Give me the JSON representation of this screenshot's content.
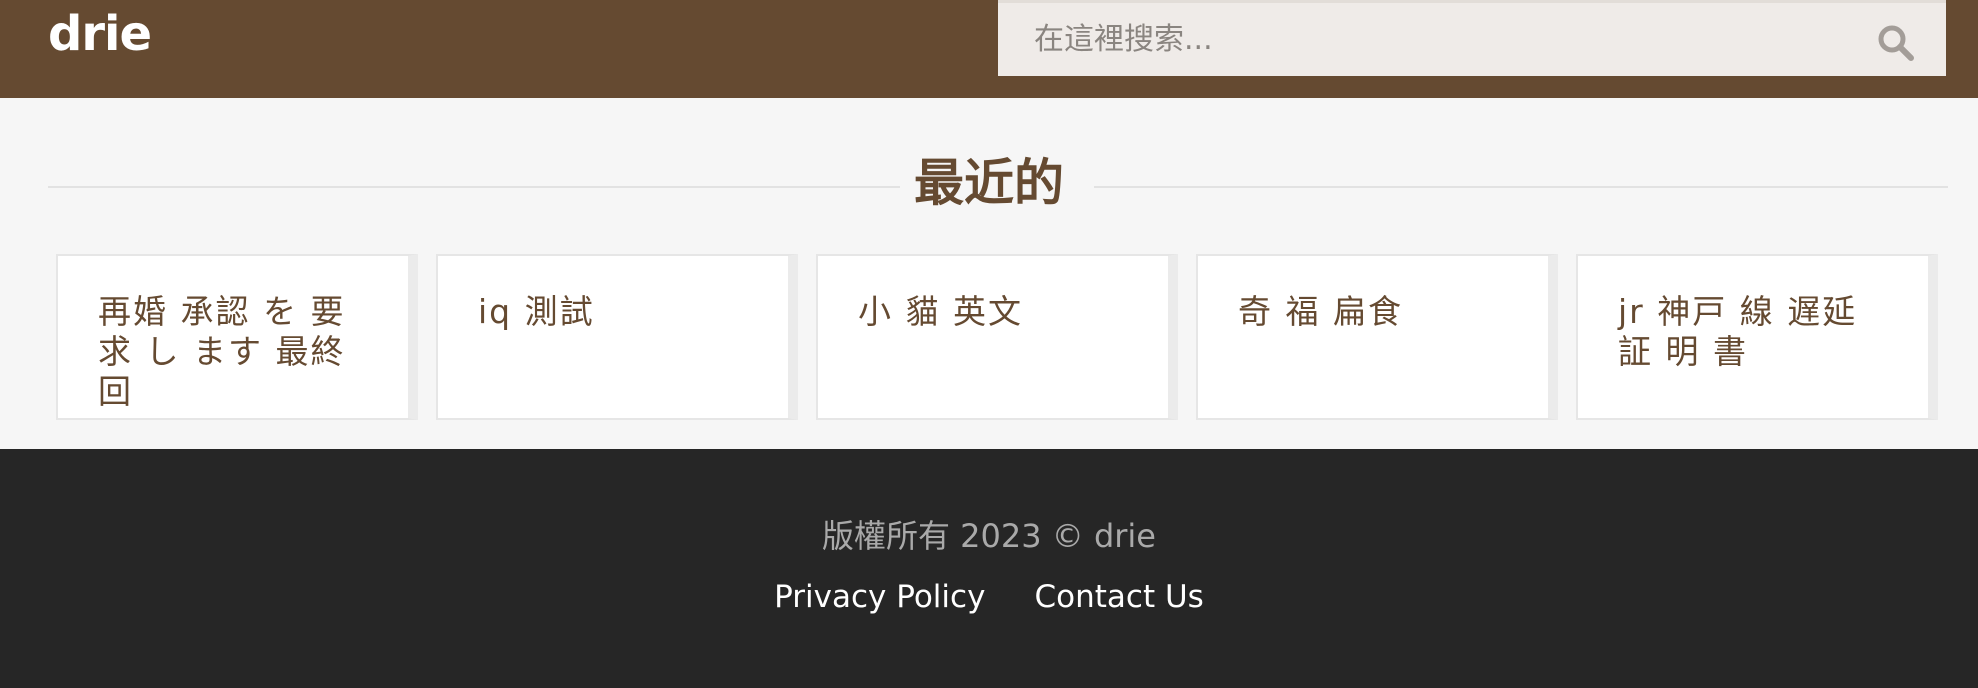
{
  "header": {
    "brand": "drie",
    "search_placeholder": "在這裡搜索..."
  },
  "recent": {
    "title": "最近的",
    "items": [
      {
        "label": "再婚 承認 を 要求 し ます 最終 回"
      },
      {
        "label": "iq 測試"
      },
      {
        "label": "小 貓 英文"
      },
      {
        "label": "奇 福 扁食"
      },
      {
        "label": "jr 神戸 線 遅延 証 明 書"
      }
    ]
  },
  "footer": {
    "copyright": "版權所有 2023 © drie",
    "links": [
      "Privacy Policy",
      "Contact Us"
    ]
  },
  "colors": {
    "header_bg": "#654a31",
    "accent": "#654a31",
    "footer_bg": "#262626"
  }
}
